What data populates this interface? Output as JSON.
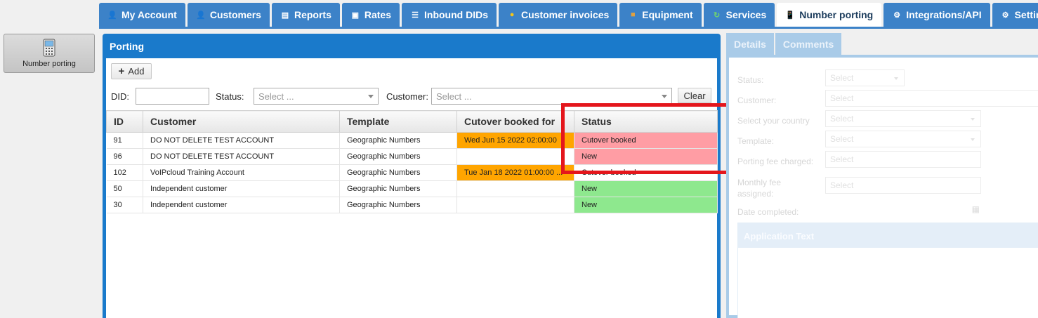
{
  "nav": {
    "tabs": [
      {
        "label": "My Account",
        "icon": "user-icon"
      },
      {
        "label": "Customers",
        "icon": "customers-icon"
      },
      {
        "label": "Reports",
        "icon": "reports-icon"
      },
      {
        "label": "Rates",
        "icon": "rates-icon"
      },
      {
        "label": "Inbound DIDs",
        "icon": "list-icon"
      },
      {
        "label": "Customer invoices",
        "icon": "coins-icon"
      },
      {
        "label": "Equipment",
        "icon": "box-icon"
      },
      {
        "label": "Services",
        "icon": "services-icon"
      },
      {
        "label": "Number porting",
        "icon": "phone-icon"
      },
      {
        "label": "Integrations/API",
        "icon": "gear-icon"
      },
      {
        "label": "Settings",
        "icon": "settings-icon"
      }
    ],
    "active_index": 8
  },
  "sidebar": {
    "number_porting_label": "Number porting"
  },
  "porting": {
    "title": "Porting",
    "add_label": "Add",
    "filters": {
      "did_label": "DID:",
      "did_value": "",
      "status_label": "Status:",
      "status_placeholder": "Select ...",
      "customer_label": "Customer:",
      "customer_placeholder": "Select ...",
      "clear_label": "Clear"
    },
    "columns": [
      "ID",
      "Customer",
      "Template",
      "Cutover booked for",
      "Status"
    ],
    "rows": [
      {
        "id": "91",
        "customer": "DO NOT DELETE TEST ACCOUNT",
        "template": "Geographic Numbers",
        "cutover": "Wed Jun 15 2022 02:00:00",
        "status": "Cutover booked",
        "status_color": "#ff9da4"
      },
      {
        "id": "96",
        "customer": "DO NOT DELETE TEST ACCOUNT",
        "template": "Geographic Numbers",
        "cutover": "",
        "status": "New",
        "status_color": "#ff9da4"
      },
      {
        "id": "102",
        "customer": "VoIPcloud Training Account",
        "template": "Geographic Numbers",
        "cutover": "Tue Jan 18 2022 01:00:00 ...",
        "status": "Cutover booked",
        "status_color": "#ffffff"
      },
      {
        "id": "50",
        "customer": "Independent customer",
        "template": "Geographic Numbers",
        "cutover": "",
        "status": "New",
        "status_color": "#8ee88e"
      },
      {
        "id": "30",
        "customer": "Independent customer",
        "template": "Geographic Numbers",
        "cutover": "",
        "status": "New",
        "status_color": "#8ee88e"
      }
    ]
  },
  "details": {
    "tabs": [
      "Details",
      "Comments"
    ],
    "fields": [
      {
        "label": "Status:",
        "value": "Select",
        "dropdown": true
      },
      {
        "label": "Customer:",
        "value": "Select",
        "dropdown": false
      },
      {
        "label": "Select your country",
        "value": "Select",
        "dropdown": true
      },
      {
        "label": "Template:",
        "value": "Select",
        "dropdown": true
      },
      {
        "label": "Porting fee charged:",
        "value": "Select",
        "dropdown": false
      },
      {
        "label": "Monthly fee assigned:",
        "value": "Select",
        "dropdown": false
      },
      {
        "label": "Date completed:",
        "value": "",
        "dropdown": false
      }
    ],
    "application_text_title": "Application Text"
  },
  "colors": {
    "brand_blue": "#1a7acb",
    "cutover_orange": "#ffa500",
    "highlight_red": "#e4161c"
  }
}
